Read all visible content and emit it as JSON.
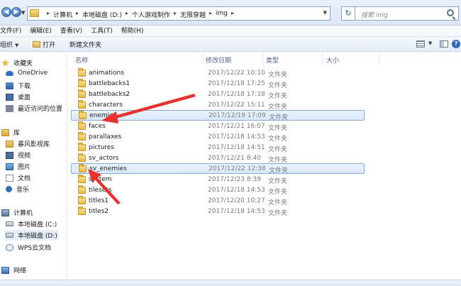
{
  "address_bar": {
    "crumbs": [
      "计算机",
      "本地磁盘 (D:)",
      "个人游戏制作",
      "无限穿越",
      "img"
    ],
    "search_placeholder": "搜索 img",
    "back_icon": "back-arrow-icon",
    "forward_icon": "forward-arrow-icon",
    "refresh_icon": "refresh-icon"
  },
  "menubar": {
    "items": [
      "文件(F)",
      "编辑(E)",
      "查看(V)",
      "工具(T)",
      "帮助(H)"
    ]
  },
  "toolbar": {
    "organize": "组织",
    "open": "打开",
    "new_folder": "新建文件夹"
  },
  "sidebar": {
    "favorites_header": "收藏夹",
    "favorites": [
      "OneDrive",
      "下载",
      "桌面",
      "最近访问的位置"
    ],
    "libraries_header": "库",
    "libraries": [
      "暴风影视库",
      "视频",
      "图片",
      "文档",
      "音乐"
    ],
    "computer_header": "计算机",
    "drives": [
      "本地磁盘 (C:)",
      "本地磁盘 (D:)",
      "WPS云文档"
    ],
    "network": "网络"
  },
  "columns": {
    "name": "名称",
    "modified": "修改日期",
    "type": "类型",
    "size": "大小"
  },
  "files": [
    {
      "name": "animations",
      "modified": "2017/12/22 10:10",
      "type": "文件夹",
      "selected": false
    },
    {
      "name": "battlebacks1",
      "modified": "2017/12/18 17:25",
      "type": "文件夹",
      "selected": false
    },
    {
      "name": "battlebacks2",
      "modified": "2017/12/18 17:18",
      "type": "文件夹",
      "selected": false
    },
    {
      "name": "characters",
      "modified": "2017/12/22 15:11",
      "type": "文件夹",
      "selected": false
    },
    {
      "name": "enemies",
      "modified": "2017/12/19 17:09",
      "type": "文件夹",
      "selected": true
    },
    {
      "name": "faces",
      "modified": "2017/12/21 16:07",
      "type": "文件夹",
      "selected": false
    },
    {
      "name": "parallaxes",
      "modified": "2017/12/18 14:53",
      "type": "文件夹",
      "selected": false
    },
    {
      "name": "pictures",
      "modified": "2017/12/18 14:51",
      "type": "文件夹",
      "selected": false
    },
    {
      "name": "sv_actors",
      "modified": "2017/12/21 8:40",
      "type": "文件夹",
      "selected": false
    },
    {
      "name": "sv_enemies",
      "modified": "2017/12/22 12:38",
      "type": "文件夹",
      "selected": true
    },
    {
      "name": "system",
      "modified": "2017/12/23 8:39",
      "type": "文件夹",
      "selected": false
    },
    {
      "name": "tilesets",
      "modified": "2017/12/18 14:53",
      "type": "文件夹",
      "selected": false
    },
    {
      "name": "titles1",
      "modified": "2017/12/20 10:27",
      "type": "文件夹",
      "selected": false
    },
    {
      "name": "titles2",
      "modified": "2017/12/18 14:53",
      "type": "文件夹",
      "selected": false
    }
  ],
  "annotations": {
    "arrow_color": "#e8312f"
  }
}
